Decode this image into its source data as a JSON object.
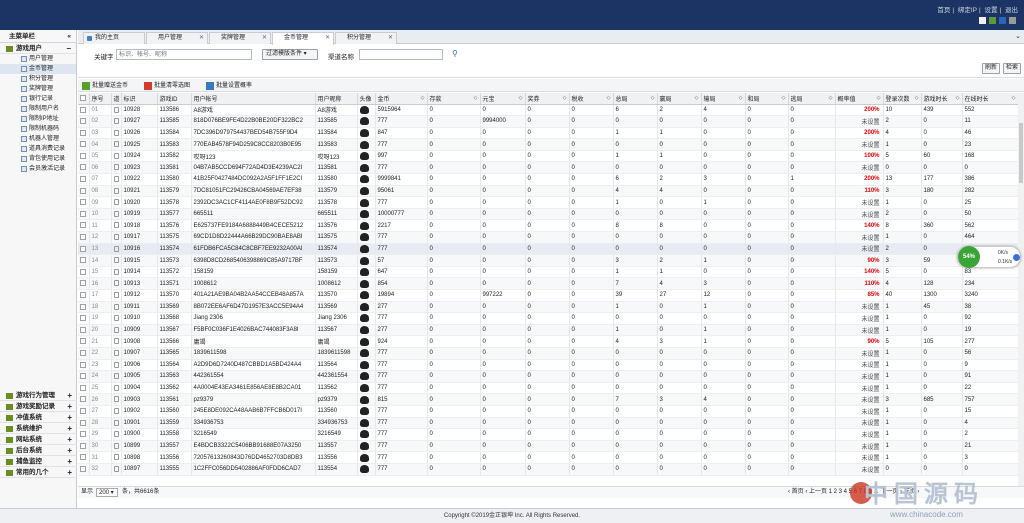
{
  "header": {
    "links": [
      "首页",
      "绑定IP",
      "设置",
      "退出"
    ]
  },
  "sidebar": {
    "title": "主菜单栏",
    "collapse_icon": "«",
    "group": "游戏用户",
    "group_toggle": "−",
    "items": [
      "用户管理",
      "金币管理",
      "积分管理",
      "奖牌管理",
      "银行记录",
      "限制用户名",
      "限制IP地址",
      "限制机器码",
      "机器人管理",
      "道具消费记录",
      "背包使用记录",
      "会员激活记录"
    ],
    "bottom_groups": [
      "游戏行为管理",
      "游戏奖励记录",
      "冲值系统",
      "系统维护",
      "网站系统",
      "后台系统",
      "捕鱼监控",
      "常用的几个"
    ]
  },
  "tabs": [
    "我的主页",
    "用户管理",
    "奖牌管理",
    "金币管理",
    "积分管理"
  ],
  "tab_arrow": "⌄",
  "filter": {
    "keyword_label": "关键字",
    "keyword_placeholder": "标识、帐号、昵称",
    "condition_select": "过滤模版条件",
    "channel_label": "渠道名称",
    "search_icon": "magnifier-icon",
    "refresh": "刷新",
    "search": "检索"
  },
  "toolbar": {
    "b1": "批量赠送金币",
    "b2": "批量清零选图",
    "b3": "批量设置概率"
  },
  "columns": [
    "序号",
    "道",
    "标识",
    "游戏ID",
    "用户帐号",
    "用户昵称",
    "头像",
    "金币",
    "存款",
    "元宝",
    "奖券",
    "税收",
    "总局",
    "赢局",
    "输局",
    "和局",
    "逃局",
    "概率值",
    "登录次数",
    "游戏时长",
    "在线时长"
  ],
  "rows": [
    [
      "01",
      "10928",
      "113586",
      "A8游戏",
      "A8游戏",
      "5915964",
      "0",
      "0",
      "0",
      "0",
      "6",
      "2",
      "4",
      "0",
      "0",
      "200%",
      "10",
      "439",
      "552"
    ],
    [
      "02",
      "10927",
      "113585",
      "818D076BE9FE4D22B0BE20DF322BC2",
      "113585",
      "777",
      "0",
      "9994000",
      "0",
      "0",
      "0",
      "0",
      "0",
      "0",
      "0",
      "未设置",
      "2",
      "0",
      "11"
    ],
    [
      "03",
      "10926",
      "113584",
      "7DC396D979754437BED54B755F9D4",
      "113584",
      "847",
      "0",
      "0",
      "0",
      "0",
      "1",
      "1",
      "0",
      "0",
      "0",
      "200%",
      "4",
      "0",
      "46"
    ],
    [
      "04",
      "10925",
      "113583",
      "770EAB4578F94D259C8CC8203B0E95",
      "113583",
      "777",
      "0",
      "0",
      "0",
      "0",
      "0",
      "0",
      "0",
      "0",
      "0",
      "未设置",
      "1",
      "0",
      "23"
    ],
    [
      "05",
      "10924",
      "113582",
      "哎呀123",
      "哎呀123",
      "997",
      "0",
      "0",
      "0",
      "0",
      "1",
      "1",
      "0",
      "0",
      "0",
      "100%",
      "5",
      "60",
      "168"
    ],
    [
      "06",
      "10923",
      "113581",
      "04B7AB5CCD694F72AD4D3E4239AC2I",
      "113581",
      "777",
      "0",
      "0",
      "0",
      "0",
      "0",
      "0",
      "0",
      "0",
      "0",
      "未设置",
      "0",
      "0",
      "0"
    ],
    [
      "07",
      "10922",
      "113580",
      "41B25F0427484DC092A2A5F1FF1E2CI",
      "113580",
      "9999841",
      "0",
      "0",
      "0",
      "0",
      "6",
      "2",
      "3",
      "0",
      "1",
      "200%",
      "13",
      "177",
      "386"
    ],
    [
      "08",
      "10921",
      "113579",
      "7DC81051FC29426CBA04569AE7EF38",
      "113579",
      "95061",
      "0",
      "0",
      "0",
      "0",
      "4",
      "4",
      "0",
      "0",
      "0",
      "110%",
      "3",
      "180",
      "282"
    ],
    [
      "09",
      "10920",
      "113578",
      "2392DC3AC1CF4114AE0F8B9F52DC92",
      "113578",
      "777",
      "0",
      "0",
      "0",
      "0",
      "1",
      "0",
      "1",
      "0",
      "0",
      "未设置",
      "1",
      "0",
      "25"
    ],
    [
      "10",
      "10919",
      "113577",
      "665511",
      "665511",
      "10000777",
      "0",
      "0",
      "0",
      "0",
      "0",
      "0",
      "0",
      "0",
      "0",
      "未设置",
      "2",
      "0",
      "50"
    ],
    [
      "11",
      "10918",
      "113576",
      "E625737FE9184A6888449B4CECE5212",
      "113576",
      "2217",
      "0",
      "0",
      "0",
      "0",
      "8",
      "8",
      "0",
      "0",
      "0",
      "140%",
      "8",
      "360",
      "562"
    ],
    [
      "12",
      "10917",
      "113575",
      "69CD1D8D22444A66B29DC90BAE8ABI",
      "113575",
      "777",
      "0",
      "0",
      "0",
      "0",
      "0",
      "0",
      "0",
      "0",
      "0",
      "未设置",
      "1",
      "0",
      "464"
    ],
    [
      "13",
      "10916",
      "113574",
      "61FDB6FCA5C84C8CBF7EE9232A00AI",
      "113574",
      "777",
      "0",
      "0",
      "0",
      "0",
      "0",
      "0",
      "0",
      "0",
      "0",
      "未设置",
      "2",
      "0",
      ""
    ],
    [
      "14",
      "10915",
      "113573",
      "6398D8CD2685406398869C85A9717BF",
      "113573",
      "57",
      "0",
      "0",
      "0",
      "0",
      "3",
      "2",
      "1",
      "0",
      "0",
      "90%",
      "3",
      "59",
      "64"
    ],
    [
      "15",
      "10914",
      "113572",
      "158159",
      "158159",
      "647",
      "0",
      "0",
      "0",
      "0",
      "1",
      "1",
      "0",
      "0",
      "0",
      "140%",
      "5",
      "0",
      "83"
    ],
    [
      "16",
      "10913",
      "113571",
      "1008612",
      "1008612",
      "854",
      "0",
      "0",
      "0",
      "0",
      "7",
      "4",
      "3",
      "0",
      "0",
      "110%",
      "4",
      "128",
      "234"
    ],
    [
      "17",
      "10912",
      "113570",
      "401A21AE9BA04B2AA54CCEB48A857A",
      "113570",
      "19894",
      "0",
      "997222",
      "0",
      "0",
      "39",
      "27",
      "12",
      "0",
      "0",
      "85%",
      "40",
      "1300",
      "3240"
    ],
    [
      "18",
      "10911",
      "113569",
      "8B072EE6AF6D47D1957E3ACC5E94A4",
      "113569",
      "277",
      "0",
      "0",
      "0",
      "0",
      "1",
      "0",
      "1",
      "0",
      "0",
      "未设置",
      "1",
      "45",
      "38"
    ],
    [
      "19",
      "10910",
      "113568",
      "Jiang 2306",
      "Jiang 2306",
      "777",
      "0",
      "0",
      "0",
      "0",
      "0",
      "0",
      "0",
      "0",
      "0",
      "未设置",
      "1",
      "0",
      "92"
    ],
    [
      "20",
      "10909",
      "113567",
      "F5BF0C036F1E4026BAC744083F3A8I",
      "113567",
      "277",
      "0",
      "0",
      "0",
      "0",
      "1",
      "0",
      "1",
      "0",
      "0",
      "未设置",
      "1",
      "0",
      "19"
    ],
    [
      "21",
      "10908",
      "113566",
      "庸竭",
      "庸竭",
      "924",
      "0",
      "0",
      "0",
      "0",
      "4",
      "3",
      "1",
      "0",
      "0",
      "90%",
      "5",
      "105",
      "277"
    ],
    [
      "22",
      "10907",
      "113565",
      "1839611598",
      "1839611598",
      "777",
      "0",
      "0",
      "0",
      "0",
      "0",
      "0",
      "0",
      "0",
      "0",
      "未设置",
      "1",
      "0",
      "56"
    ],
    [
      "23",
      "10906",
      "113564",
      "A2D9D6D7240D487CBBD1A5BD424A4",
      "113564",
      "777",
      "0",
      "0",
      "0",
      "0",
      "0",
      "0",
      "0",
      "0",
      "0",
      "未设置",
      "1",
      "0",
      "9"
    ],
    [
      "24",
      "10905",
      "113563",
      "442361554",
      "442361554",
      "777",
      "0",
      "0",
      "0",
      "0",
      "0",
      "0",
      "0",
      "0",
      "0",
      "未设置",
      "1",
      "0",
      "91"
    ],
    [
      "25",
      "10904",
      "113562",
      "4A0004E43EA3461E856AE8E8B2CA01",
      "113562",
      "777",
      "0",
      "0",
      "0",
      "0",
      "0",
      "0",
      "0",
      "0",
      "0",
      "未设置",
      "1",
      "0",
      "22"
    ],
    [
      "26",
      "10903",
      "113561",
      "pz9379",
      "pz9379",
      "815",
      "0",
      "0",
      "0",
      "0",
      "7",
      "3",
      "4",
      "0",
      "0",
      "未设置",
      "3",
      "685",
      "757"
    ],
    [
      "27",
      "10902",
      "113560",
      "245E8DE092CA48AAB6B7FFCB6D017I",
      "113560",
      "777",
      "0",
      "0",
      "0",
      "0",
      "0",
      "0",
      "0",
      "0",
      "0",
      "未设置",
      "1",
      "0",
      "15"
    ],
    [
      "28",
      "10901",
      "113559",
      "334936753",
      "334936753",
      "777",
      "0",
      "0",
      "0",
      "0",
      "0",
      "0",
      "0",
      "0",
      "0",
      "未设置",
      "1",
      "0",
      "4"
    ],
    [
      "29",
      "10900",
      "113558",
      "3216549",
      "3216549",
      "777",
      "0",
      "0",
      "0",
      "0",
      "0",
      "0",
      "0",
      "0",
      "0",
      "未设置",
      "1",
      "0",
      "2"
    ],
    [
      "30",
      "10899",
      "113557",
      "E4BDCB3322C5406BB91688E07A3250",
      "113557",
      "777",
      "0",
      "0",
      "0",
      "0",
      "0",
      "0",
      "0",
      "0",
      "0",
      "未设置",
      "1",
      "0",
      "21"
    ],
    [
      "31",
      "10898",
      "113556",
      "72057613260843D76DD4652703D8DB3",
      "113556",
      "777",
      "0",
      "0",
      "0",
      "0",
      "0",
      "0",
      "0",
      "0",
      "0",
      "未设置",
      "1",
      "0",
      "3"
    ],
    [
      "32",
      "10897",
      "113555",
      "1C2FFC056DD5402886AF0FDD6CAD7",
      "113554",
      "777",
      "0",
      "0",
      "0",
      "0",
      "0",
      "0",
      "0",
      "0",
      "0",
      "未设置",
      "0",
      "0",
      "0"
    ]
  ],
  "pager": {
    "show": "显示",
    "size": "200",
    "suffix": "条，共6616条",
    "nav": "‹ 首页 ‹ 上一页 1 2 3 4 5 6 7 8 9 ... 下一页 › 末页 ›"
  },
  "footer": "Copyright ©2019金正银坤 Inc. All Rights Reserved.",
  "widget": {
    "percent": "54%",
    "up": "0K/s",
    "down": "0.1K/s"
  },
  "watermark": {
    "big": "中国源码",
    "url": "www.chinacode.com"
  }
}
